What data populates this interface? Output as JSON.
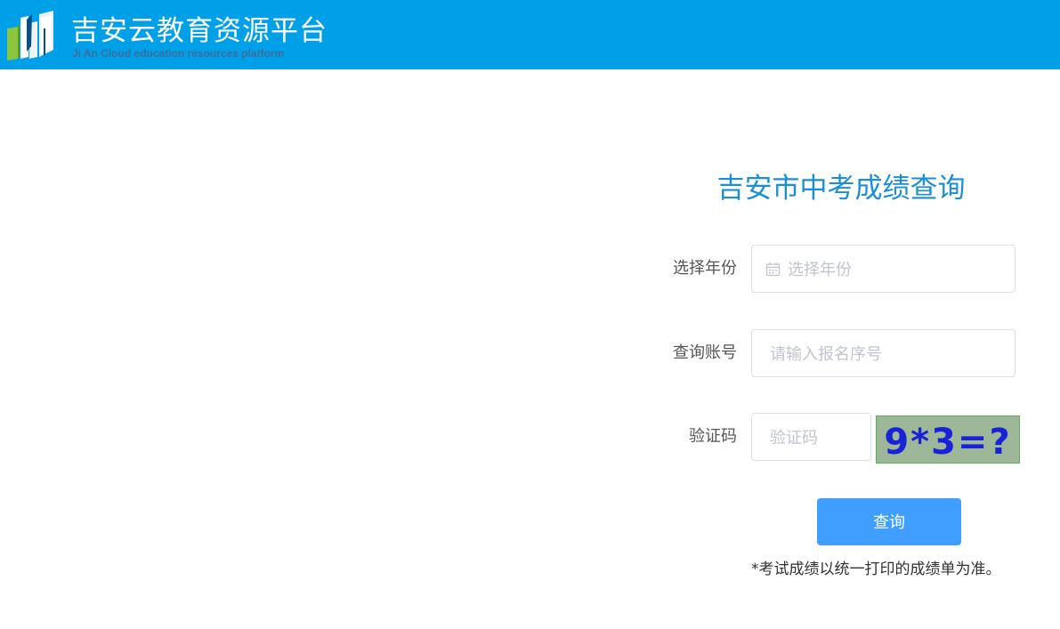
{
  "header": {
    "title": "吉安云教育资源平台",
    "subtitle": "Ji An Cloud education resources platform",
    "background_color": "#00a0e9",
    "logo_icon": "book-logo-icon"
  },
  "form": {
    "title": "吉安市中考成绩查询",
    "year": {
      "label": "选择年份",
      "placeholder": "选择年份",
      "icon": "calendar-icon"
    },
    "account": {
      "label": "查询账号",
      "placeholder": "请输入报名序号"
    },
    "captcha": {
      "label": "验证码",
      "placeholder": "验证码",
      "image_text": "9*3=?"
    },
    "submit_label": "查询",
    "note": "*考试成绩以统一打印的成绩单为准。"
  },
  "colors": {
    "accent": "#409eff",
    "title": "#1a8fd6"
  }
}
